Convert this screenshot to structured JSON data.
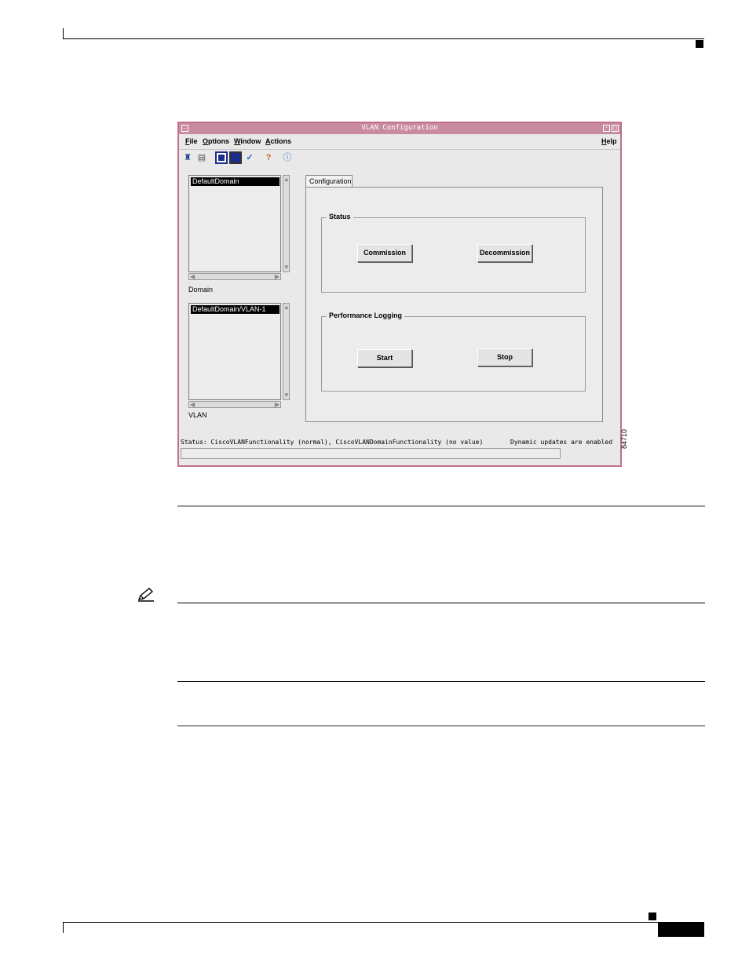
{
  "window": {
    "title": "VLAN Configuration",
    "menus": [
      "File",
      "Options",
      "Window",
      "Actions"
    ],
    "help_menu": "Help",
    "toolbar_icons": [
      "user-icon",
      "printer-icon",
      "list-icon",
      "monitor-icon",
      "checkmark-icon",
      "help-icon",
      "info-icon"
    ]
  },
  "domain_list": {
    "selected": "DefaultDomain",
    "label": "Domain"
  },
  "vlan_list": {
    "selected": "DefaultDomain/VLAN-1",
    "label": "VLAN"
  },
  "tab": {
    "label": "Configuration"
  },
  "status_group": {
    "title": "Status",
    "commission_label": "Commission",
    "decommission_label": "Decommission"
  },
  "perf_group": {
    "title": "Performance Logging",
    "start_label": "Start",
    "stop_label": "Stop"
  },
  "statusbar": {
    "text": "Status: CiscoVLANFunctionality (normal), CiscoVLANDomainFunctionality (no value)",
    "updates": "Dynamic updates are enabled"
  },
  "figure_number": "84710",
  "colors": {
    "window_border": "#c0708c",
    "titlebar": "#c98ba0"
  }
}
